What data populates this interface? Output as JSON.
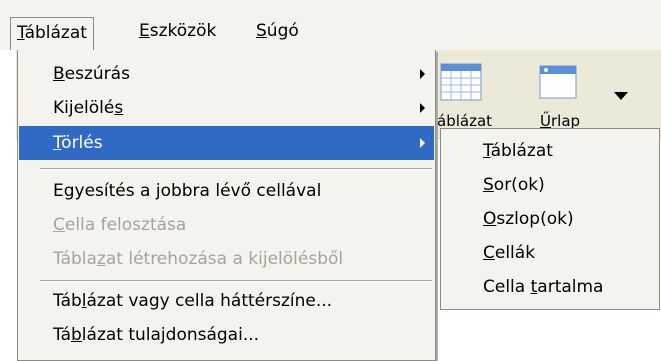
{
  "menubar": {
    "items": [
      {
        "label_pre": "",
        "label_u": "T",
        "label_post": "áblázat"
      },
      {
        "label_pre": "",
        "label_u": "E",
        "label_post": "szközök"
      },
      {
        "label_pre": "",
        "label_u": "S",
        "label_post": "úgó"
      }
    ]
  },
  "toolbar": {
    "table_label": "áblázat",
    "form_label_u": "Ű",
    "form_label_post": "rlap"
  },
  "menu": {
    "items": [
      {
        "pre": "",
        "u": "B",
        "post": "eszúrás",
        "submenu": true,
        "disabled": false
      },
      {
        "pre": "Kijelölé",
        "u": "s",
        "post": "",
        "submenu": true,
        "disabled": false
      },
      {
        "pre": "",
        "u": "T",
        "post": "örlés",
        "submenu": true,
        "disabled": false,
        "active": true
      },
      {
        "pre": "Egyesítés a ",
        "u": "j",
        "post": "obbra lévő cellával",
        "submenu": false,
        "disabled": false
      },
      {
        "pre": "",
        "u": "C",
        "post": "ella felosztása",
        "submenu": false,
        "disabled": true
      },
      {
        "pre": "Tábla",
        "u": "z",
        "post": "at létrehozása a kijelölésből",
        "submenu": false,
        "disabled": true
      },
      {
        "pre": "Táb",
        "u": "l",
        "post": "ázat vagy cella háttérszíne...",
        "submenu": false,
        "disabled": false
      },
      {
        "pre": "Tá",
        "u": "b",
        "post": "lázat tulajdonságai...",
        "submenu": false,
        "disabled": false
      }
    ]
  },
  "submenu": {
    "items": [
      {
        "pre": "",
        "u": "T",
        "post": "áblázat"
      },
      {
        "pre": "",
        "u": "S",
        "post": "or(ok)"
      },
      {
        "pre": "",
        "u": "O",
        "post": "szlop(ok)"
      },
      {
        "pre": "",
        "u": "C",
        "post": "ellák"
      },
      {
        "pre": "Cella ",
        "u": "t",
        "post": "artalma"
      }
    ]
  },
  "colors": {
    "highlight": "#316ac5",
    "menu_bg": "#f4f3ee",
    "disabled_text": "#a6a39a"
  }
}
